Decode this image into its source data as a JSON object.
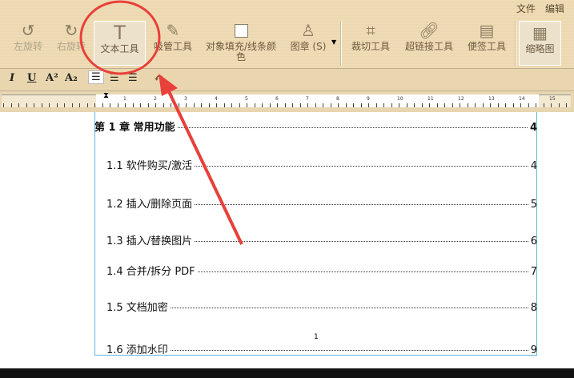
{
  "menu": [
    "文件",
    "编辑"
  ],
  "tools": [
    {
      "label": "左旋转",
      "icon": "rotate-left-icon"
    },
    {
      "label": "右旋转",
      "icon": "rotate-right-icon"
    },
    {
      "label": "文本工具",
      "icon": "text-tool-icon"
    },
    {
      "label": "吸管工具",
      "icon": "eyedropper-icon"
    },
    {
      "label": "对象填充/线条颜色",
      "icon": "fill-color-icon"
    },
    {
      "label": "图章 (S)",
      "icon": "stamp-icon"
    },
    {
      "label": "裁切工具",
      "icon": "crop-icon"
    },
    {
      "label": "超链接工具",
      "icon": "link-icon"
    },
    {
      "label": "便签工具",
      "icon": "note-icon"
    },
    {
      "label": "缩略图",
      "icon": "thumbnail-icon"
    }
  ],
  "format": {
    "italic": "I",
    "underline": "U",
    "superscript": "A²",
    "subscript": "A₂"
  },
  "ruler": [
    "1",
    "2",
    "3",
    "4",
    "5",
    "6",
    "7",
    "8",
    "9",
    "10",
    "11",
    "12",
    "13",
    "14",
    "15"
  ],
  "toc": [
    {
      "title": "第 1 章  常用功能",
      "page": "4"
    },
    {
      "title": "1.1 软件购买/激活",
      "page": "4"
    },
    {
      "title": "1.2 插入/删除页面",
      "page": "5"
    },
    {
      "title": "1.3 插入/替换图片",
      "page": "6"
    },
    {
      "title": "1.4 合并/拆分 PDF",
      "page": "7"
    },
    {
      "title": "1.5 文档加密",
      "page": "8"
    },
    {
      "title": "1.6 添加水印",
      "page": "9"
    }
  ],
  "page_number": "1"
}
